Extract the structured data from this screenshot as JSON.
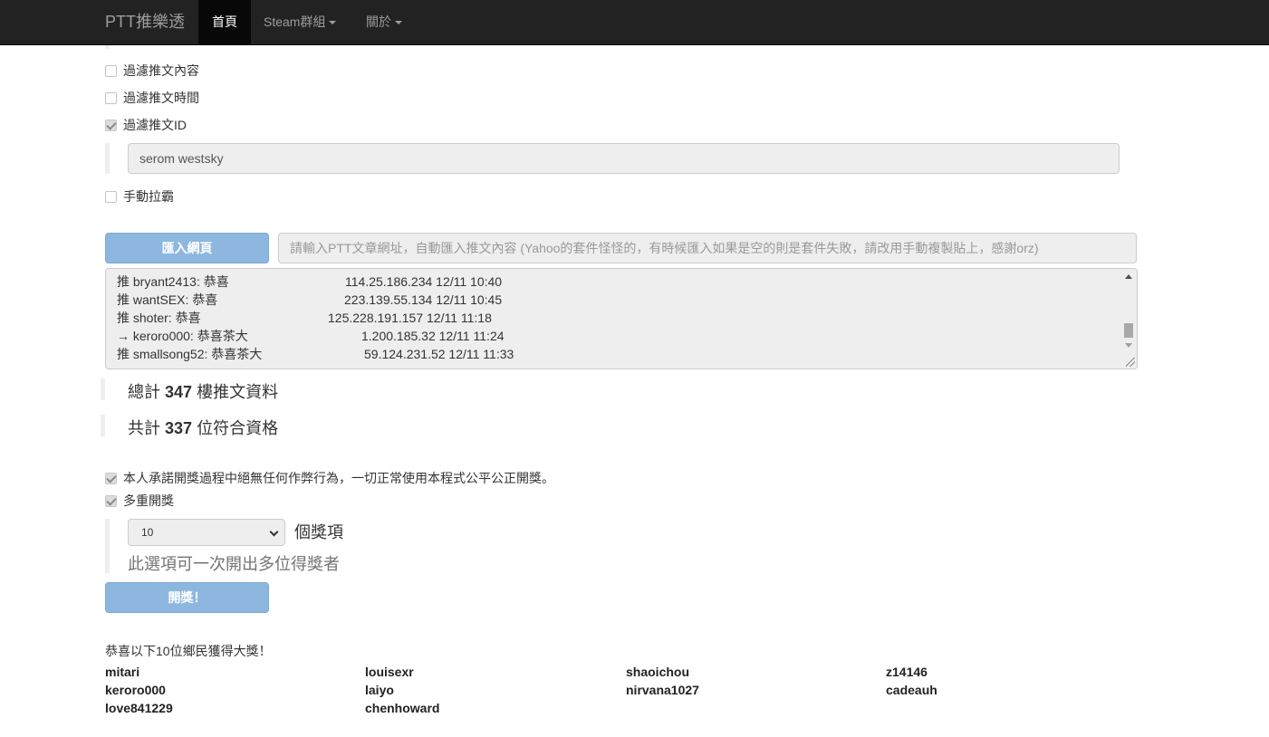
{
  "navbar": {
    "brand": "PTT推樂透",
    "items": [
      {
        "label": "首頁",
        "active": true
      },
      {
        "label": "Steam群組",
        "dropdown": true
      },
      {
        "label": "關於",
        "dropdown": true
      }
    ]
  },
  "filters": {
    "filter_content": {
      "label": "過濾推文內容",
      "checked": false
    },
    "filter_time": {
      "label": "過濾推文時間",
      "checked": false
    },
    "filter_id": {
      "label": "過濾推文ID",
      "checked": true
    },
    "filter_id_value": "serom westsky",
    "manual_paste": {
      "label": "手動拉霸",
      "checked": false
    }
  },
  "import": {
    "button_label": "匯入網頁",
    "url_placeholder": "請輸入PTT文章網址，自動匯入推文內容 (Yahoo的套件怪怪的，有時候匯入如果是空的則是套件失敗，請改用手動複製貼上，感謝orz)"
  },
  "pushes": [
    {
      "text": "推 bryant2413: 恭喜",
      "meta": "114.25.186.234 12/11 10:40"
    },
    {
      "text": "推 wantSEX: 恭喜",
      "meta": "223.139.55.134 12/11 10:45"
    },
    {
      "text": "推 shoter: 恭喜",
      "meta": "125.228.191.157 12/11 11:18"
    },
    {
      "text": "→ keroro000: 恭喜茶大",
      "meta": "1.200.185.32 12/11 11:24"
    },
    {
      "text": "推 smallsong52: 恭喜茶大",
      "meta": "59.124.231.52 12/11 11:33"
    }
  ],
  "stats": {
    "total_prefix": "總計",
    "total_count": "347",
    "total_suffix": "樓推文資料",
    "qualified_prefix": "共計",
    "qualified_count": "337",
    "qualified_suffix": "位符合資格"
  },
  "draw": {
    "promise": {
      "label": "本人承諾開獎過程中絕無任何作弊行為，一切正常使用本程式公平公正開獎。",
      "checked": true
    },
    "multi": {
      "label": "多重開獎",
      "checked": true
    },
    "prize_count": "10",
    "prize_unit": "個獎項",
    "multi_hint": "此選項可一次開出多位得獎者",
    "button_label": "開獎！"
  },
  "results": {
    "heading": "恭喜以下10位鄉民獲得大獎！",
    "winners": [
      "mitari",
      "louisexr",
      "shaoichou",
      "z14146",
      "keroro000",
      "laiyo",
      "nirvana1027",
      "cadeauh",
      "love841229",
      "chenhoward"
    ]
  }
}
